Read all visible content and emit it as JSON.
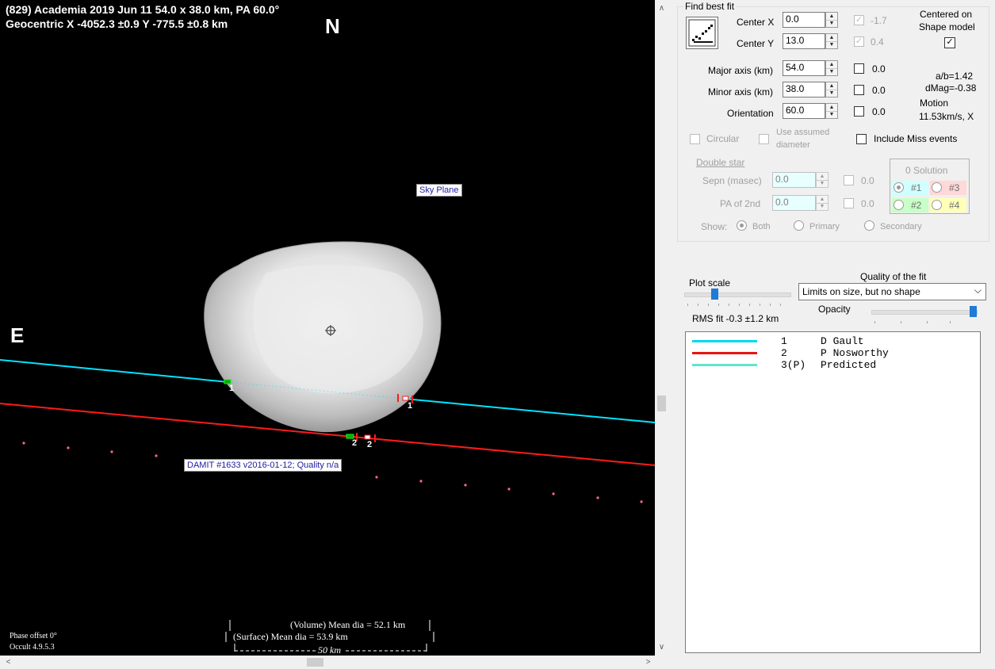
{
  "plot": {
    "title_line1": "(829) Academia  2019 Jun 11  54.0 x 38.0 km, PA 60.0°",
    "title_line2": "Geocentric  X  -4052.3 ±0.9  Y -775.5 ±0.8 km",
    "north_label": "N",
    "east_label": "E",
    "sky_plane_label": "Sky Plane",
    "damit_label": "DAMIT #1633 v2016-01-12; Quality n/a",
    "chord_labels": [
      "1",
      "1",
      "2",
      "2"
    ],
    "volume_dia": "(Volume) Mean dia = 52.1 km",
    "surface_dia": "(Surface) Mean dia = 53.9 km",
    "scale_label": "50 km",
    "phase_offset": "Phase offset 0°",
    "version": "Occult 4.9.5.3",
    "colors": {
      "chord1": "#00e5ff",
      "chord2": "#ff1a1a",
      "predicted": "#5fe6c8",
      "dots": "#ff6688"
    }
  },
  "panel": {
    "find_best_fit": "Find best fit",
    "center_x_label": "Center X",
    "center_x_value": "0.0",
    "center_x_result": "-1.7",
    "center_y_label": "Center Y",
    "center_y_value": "13.0",
    "center_y_result": "0.4",
    "centered_on": "Centered on",
    "shape_model": "Shape model",
    "major_axis_label": "Major axis (km)",
    "major_axis_value": "54.0",
    "major_axis_result": "0.0",
    "minor_axis_label": "Minor axis (km)",
    "minor_axis_value": "38.0",
    "minor_axis_result": "0.0",
    "orientation_label": "Orientation",
    "orientation_value": "60.0",
    "orientation_result": "0.0",
    "ab_ratio": "a/b=1.42",
    "dmag": "dMag=-0.38",
    "motion_label": "Motion",
    "motion_value": "11.53km/s, X",
    "circular": "Circular",
    "use_assumed_1": "Use assumed",
    "use_assumed_2": "diameter",
    "include_miss": "Include Miss events",
    "double_star": "Double star",
    "sepn_label": "Sepn (masec)",
    "sepn_value": "0.0",
    "sepn_result": "0.0",
    "pa2_label": "PA of 2nd",
    "pa2_value": "0.0",
    "pa2_result": "0.0",
    "solution_title": "0 Solution",
    "sol1": "#1",
    "sol2": "#2",
    "sol3": "#3",
    "sol4": "#4",
    "show_label": "Show:",
    "show_both": "Both",
    "show_primary": "Primary",
    "show_secondary": "Secondary",
    "plot_scale": "Plot scale",
    "quality_title": "Quality of the fit",
    "quality_value": "Limits on size, but no shape",
    "opacity": "Opacity",
    "rms_fit": "RMS fit -0.3 ±1.2 km"
  },
  "legend": [
    {
      "num": "1",
      "name": "D Gault",
      "color": "#00d8f0"
    },
    {
      "num": "2",
      "name": "P Nosworthy",
      "color": "#e61414"
    },
    {
      "num": "3(P)",
      "name": "Predicted",
      "color": "#5fe6c8"
    }
  ]
}
